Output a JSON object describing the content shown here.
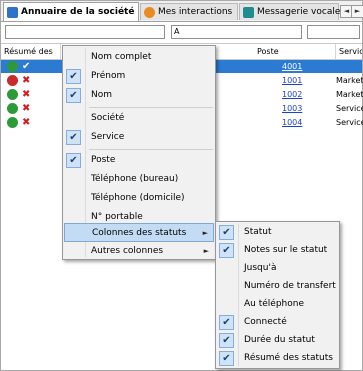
{
  "tabs": [
    {
      "label": "Annuaire de la société",
      "icon": "address-book-icon",
      "active": true
    },
    {
      "label": "Mes interactions",
      "icon": "interactions-icon",
      "active": false
    },
    {
      "label": "Messagerie vocale",
      "icon": "voicemail-icon",
      "active": false
    }
  ],
  "tab_nav": {
    "prev": "◄",
    "next": "►"
  },
  "filters": {
    "poste_value": "A"
  },
  "columns": [
    "Résumé des",
    "Poste",
    "Servic"
  ],
  "rows": [
    {
      "status": "available",
      "mark": "✔",
      "poste": "4001",
      "service": "",
      "selected": true
    },
    {
      "status": "busy",
      "mark": "✖",
      "poste": "1001",
      "service": "Marketi",
      "selected": false
    },
    {
      "status": "available",
      "mark": "✖",
      "poste": "1002",
      "service": "Marketi",
      "selected": false
    },
    {
      "status": "available",
      "mark": "✖",
      "poste": "1003",
      "service": "Service",
      "selected": false
    },
    {
      "status": "available",
      "mark": "✖",
      "poste": "1004",
      "service": "Service",
      "selected": false
    }
  ],
  "context_menu": {
    "items": [
      {
        "label": "Nom complet",
        "checked": false
      },
      {
        "label": "Prénom",
        "checked": true
      },
      {
        "label": "Nom",
        "checked": true
      },
      {
        "label": "Société",
        "checked": false
      },
      {
        "label": "Service",
        "checked": true
      },
      {
        "label": "Poste",
        "checked": true
      },
      {
        "label": "Téléphone (bureau)",
        "checked": false
      },
      {
        "label": "Téléphone (domicile)",
        "checked": false
      },
      {
        "label": "N° portable",
        "checked": false
      },
      {
        "label": "Colonnes des statuts",
        "checked": false,
        "submenu": true,
        "highlighted": true
      },
      {
        "label": "Autres colonnes",
        "checked": false,
        "submenu": true
      }
    ],
    "submenu_arrow": "►"
  },
  "status_submenu": {
    "items": [
      {
        "label": "Statut",
        "checked": true
      },
      {
        "label": "Notes sur le statut",
        "checked": true
      },
      {
        "label": "Jusqu'à",
        "checked": false
      },
      {
        "label": "Numéro de transfert",
        "checked": false
      },
      {
        "label": "Au téléphone",
        "checked": false
      },
      {
        "label": "Connecté",
        "checked": true
      },
      {
        "label": "Durée du statut",
        "checked": true
      },
      {
        "label": "Résumé des statuts",
        "checked": true
      }
    ]
  },
  "check_glyph": "✔",
  "colors": {
    "selection": "#2b7bd3",
    "link": "#1d3fcf",
    "menu_highlight": "#c3dcf4"
  }
}
